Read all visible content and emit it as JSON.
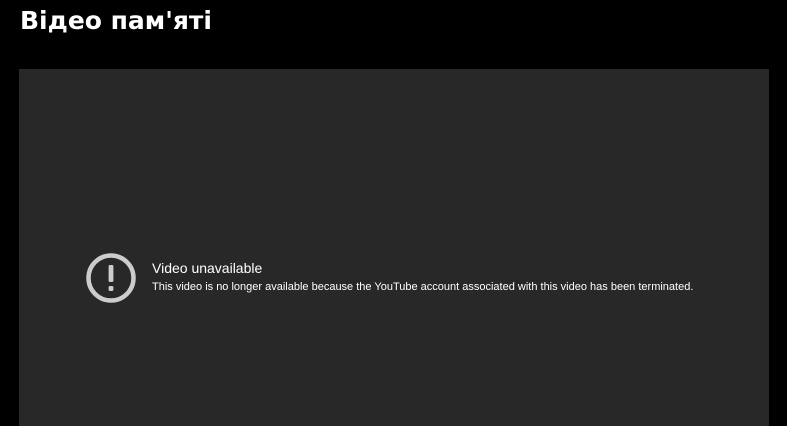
{
  "page": {
    "title": "Відео пам'яті"
  },
  "video": {
    "error_icon": "exclamation-circle-icon",
    "error_title": "Video unavailable",
    "error_message": "This video is no longer available because the YouTube account associated with this video has been terminated."
  },
  "colors": {
    "page_background": "#000000",
    "player_background": "#282828",
    "icon_color": "#cccccc",
    "text_color": "#ffffff"
  }
}
